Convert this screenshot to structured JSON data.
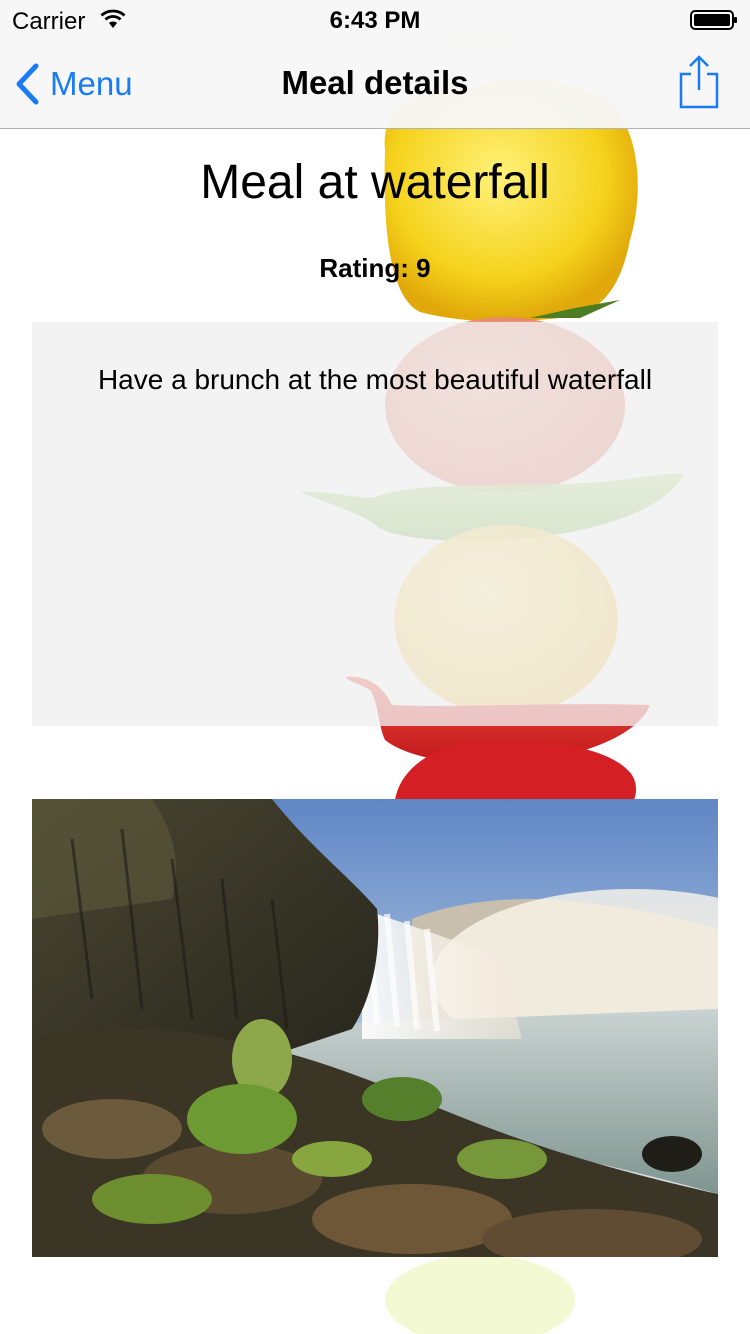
{
  "status_bar": {
    "carrier": "Carrier",
    "time": "6:43 PM"
  },
  "nav": {
    "back_label": "Menu",
    "title": "Meal details",
    "share_icon": "share-icon"
  },
  "meal": {
    "title": "Meal at waterfall",
    "rating": "Rating: 9",
    "description": "Have a brunch at the most beautiful waterfall"
  },
  "colors": {
    "accent": "#1a7cf5",
    "nav_background": "#f7f7f7",
    "description_background": "#efefef"
  }
}
